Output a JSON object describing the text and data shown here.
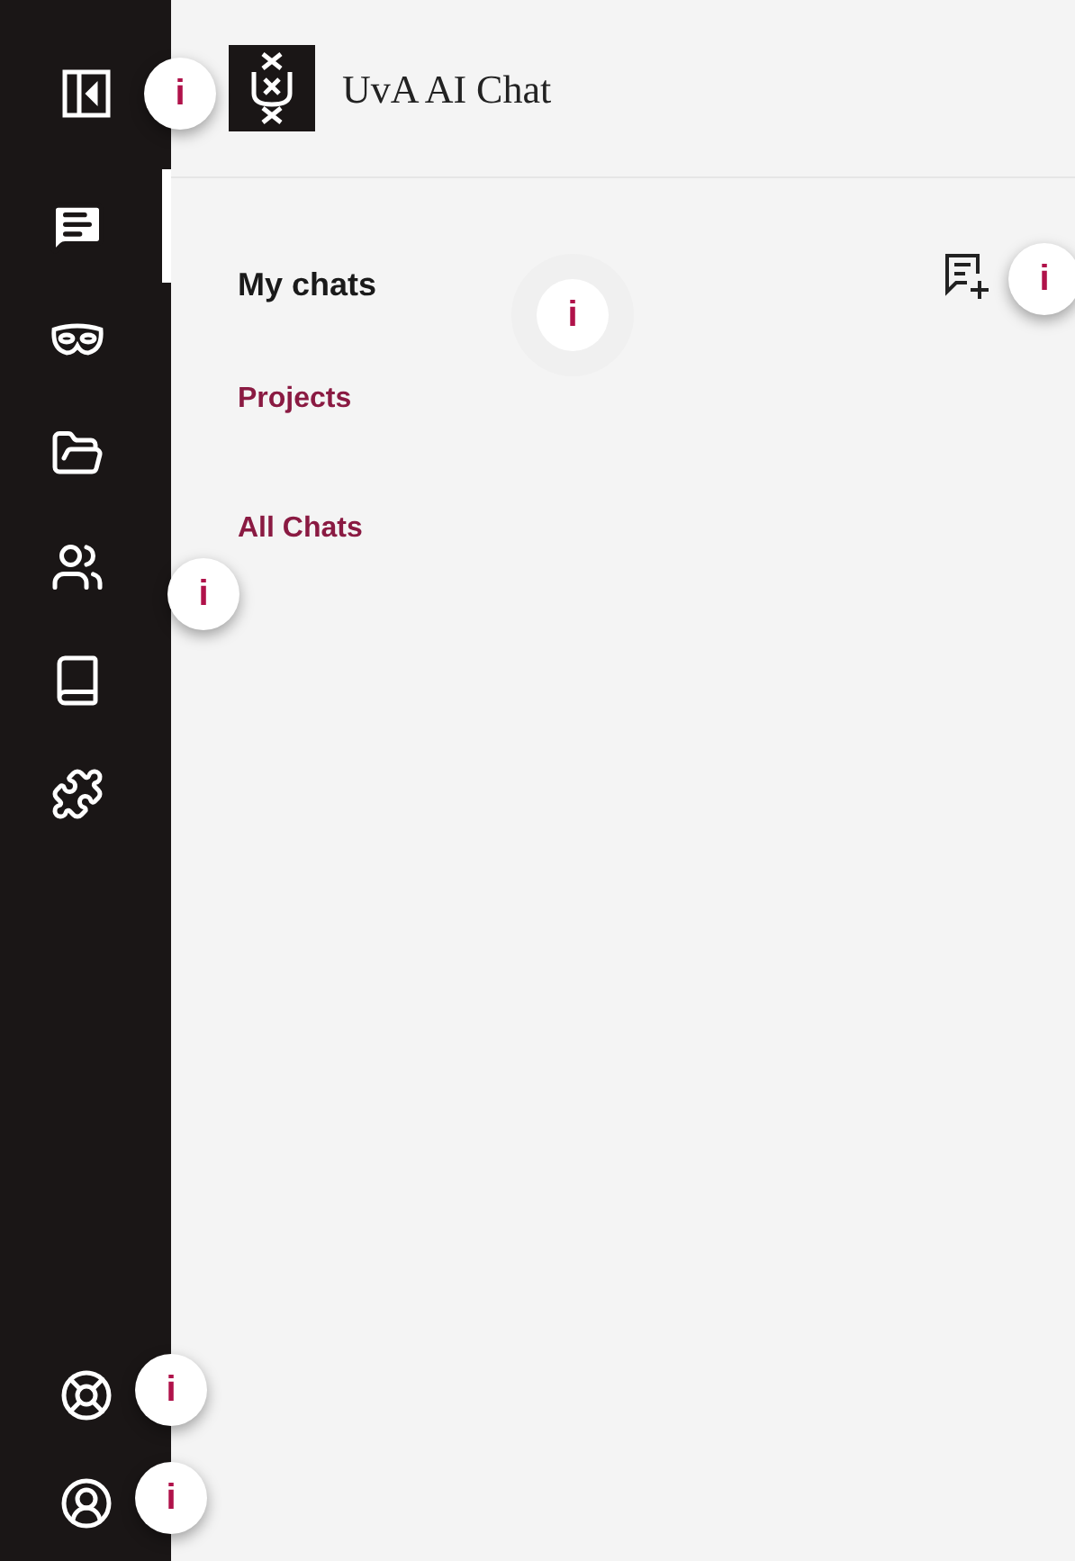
{
  "app": {
    "title": "UvA AI Chat"
  },
  "rail": [
    {
      "kind": "chat",
      "selected": true
    },
    {
      "kind": "mask",
      "selected": false
    },
    {
      "kind": "folder",
      "selected": false
    },
    {
      "kind": "people",
      "selected": false
    },
    {
      "kind": "book",
      "selected": false
    },
    {
      "kind": "puzzle",
      "selected": false
    }
  ],
  "rail_bottom": [
    {
      "kind": "help"
    },
    {
      "kind": "account"
    }
  ],
  "panel": {
    "heading": "My chats",
    "links": [
      {
        "label": "Projects"
      },
      {
        "label": "All Chats"
      }
    ]
  },
  "hints": [
    {
      "label": "i"
    },
    {
      "label": "i"
    },
    {
      "label": "i"
    },
    {
      "label": "i"
    },
    {
      "label": "i"
    },
    {
      "label": "i"
    }
  ]
}
